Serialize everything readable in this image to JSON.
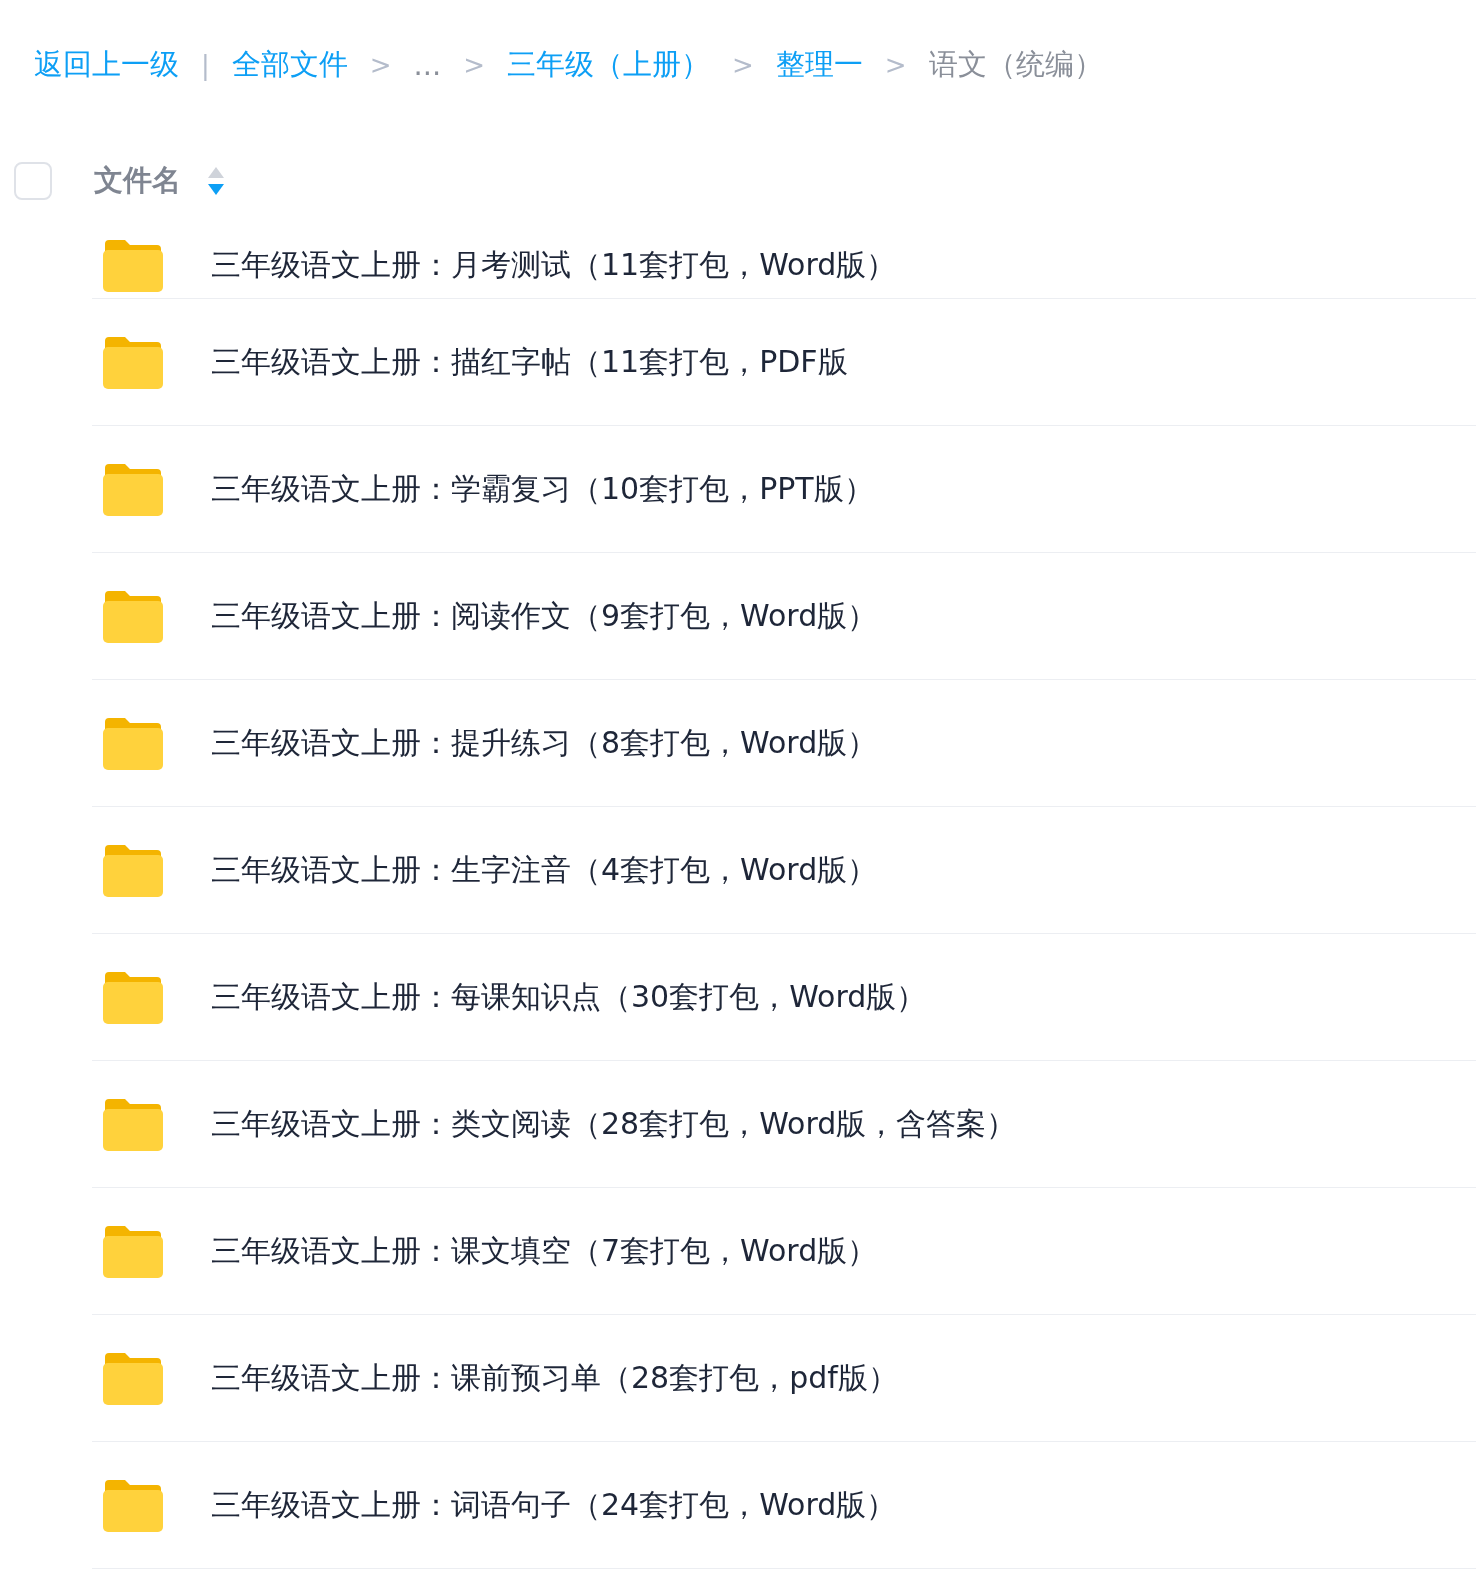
{
  "breadcrumb": {
    "back": "返回上一级",
    "divider": "|",
    "items": [
      {
        "label": "全部文件",
        "kind": "link"
      },
      {
        "sep": ">",
        "label": "...",
        "kind": "ellipsis"
      },
      {
        "sep": ">",
        "label": "三年级（上册）",
        "kind": "link"
      },
      {
        "sep": ">",
        "label": "整理一",
        "kind": "link"
      },
      {
        "sep": ">",
        "label": "语文（统编）",
        "kind": "current"
      }
    ]
  },
  "header": {
    "checked": false,
    "column": "文件名",
    "sort_descending": true
  },
  "files": [
    {
      "name": "三年级语文上册：月考测试（11套打包，Word版）"
    },
    {
      "name": "三年级语文上册：描红字帖（11套打包，PDF版"
    },
    {
      "name": "三年级语文上册：学霸复习（10套打包，PPT版）"
    },
    {
      "name": "三年级语文上册：阅读作文（9套打包，Word版）"
    },
    {
      "name": "三年级语文上册：提升练习（8套打包，Word版）"
    },
    {
      "name": "三年级语文上册：生字注音（4套打包，Word版）"
    },
    {
      "name": "三年级语文上册：每课知识点（30套打包，Word版）"
    },
    {
      "name": "三年级语文上册：类文阅读（28套打包，Word版，含答案）"
    },
    {
      "name": "三年级语文上册：课文填空（7套打包，Word版）"
    },
    {
      "name": "三年级语文上册：课前预习单（28套打包，pdf版）"
    },
    {
      "name": "三年级语文上册：词语句子（24套打包，Word版）"
    }
  ]
}
